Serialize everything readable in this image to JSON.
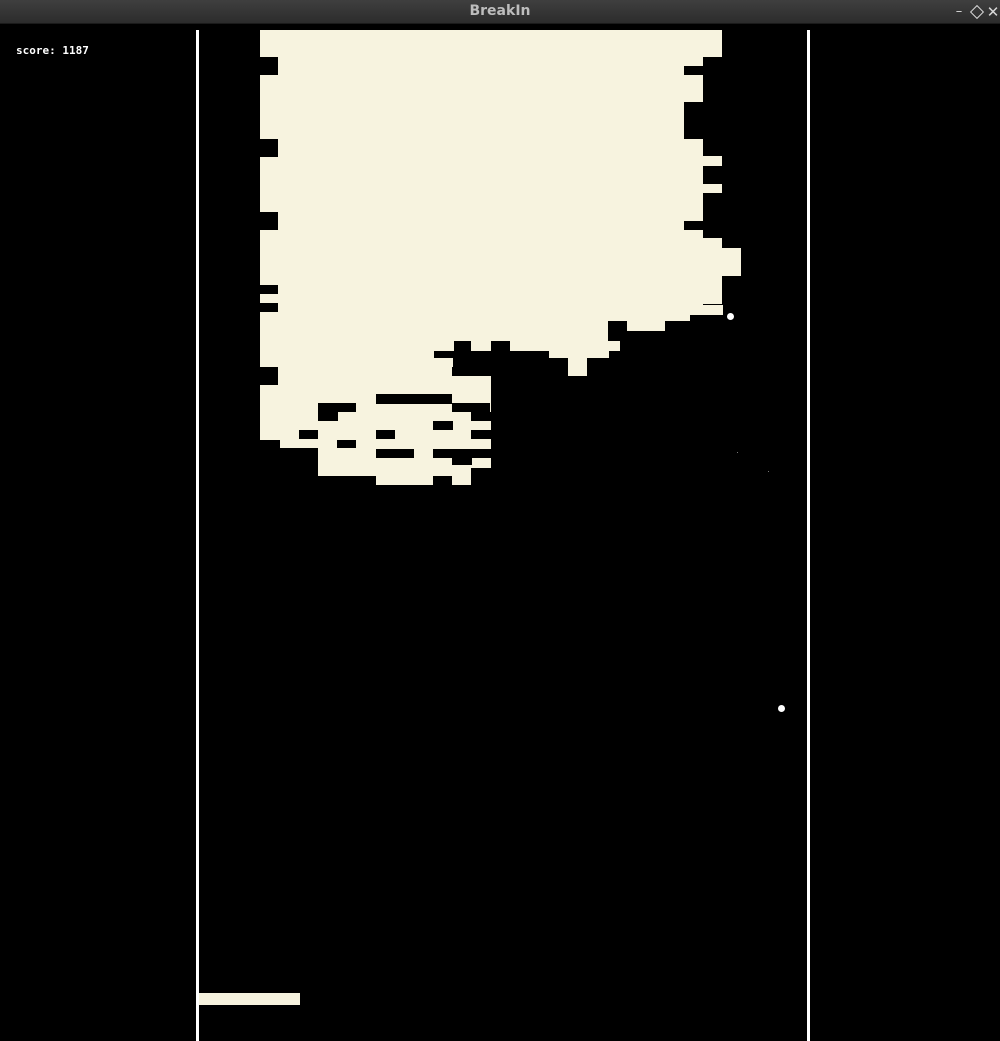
{
  "window": {
    "title": "BreakIn",
    "minimize_glyph": "–",
    "close_glyph": "✕"
  },
  "hud": {
    "score_text": "score: 1187"
  },
  "colors": {
    "background": "#000000",
    "brick": "#f7f3df",
    "wall": "#ffffff",
    "ball": "#ffffff",
    "paddle": "#f7f3df"
  },
  "game": {
    "balls_in_play": 2,
    "paddle_count": 1
  }
}
